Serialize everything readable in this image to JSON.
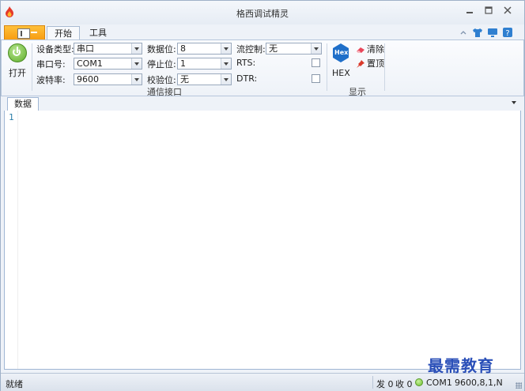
{
  "window": {
    "title": "格西调试精灵"
  },
  "tabs": [
    {
      "label": "开始",
      "active": true
    },
    {
      "label": "工具",
      "active": false
    }
  ],
  "ribbon": {
    "open_label": "打开",
    "fields": {
      "device_type": {
        "label": "设备类型:",
        "value": "串口"
      },
      "port": {
        "label": "串口号:",
        "value": "COM1"
      },
      "baud": {
        "label": "波特率:",
        "value": "9600"
      },
      "data_bits": {
        "label": "数据位:",
        "value": "8"
      },
      "stop_bits": {
        "label": "停止位:",
        "value": "1"
      },
      "parity": {
        "label": "校验位:",
        "value": "无"
      },
      "flow": {
        "label": "流控制:",
        "value": "无"
      },
      "rts": {
        "label": "RTS:",
        "checked": false
      },
      "dtr": {
        "label": "DTR:",
        "checked": false
      }
    },
    "group_comm": "通信接口",
    "hex_badge": "Hex",
    "hex_label": "HEX",
    "clear_label": "清除",
    "pin_label": "置顶",
    "group_display": "显示"
  },
  "document": {
    "tab_label": "数据",
    "lines": [
      "1"
    ]
  },
  "status": {
    "ready": "就绪",
    "sent": "发 0",
    "received": "收 0",
    "port": "COM1",
    "settings": "9600,8,1,N"
  },
  "watermark": "最需教育",
  "colors": {
    "accent": "#f79b0f",
    "hex_blue": "#1f6fc9",
    "led_green": "#6cbf2e"
  }
}
